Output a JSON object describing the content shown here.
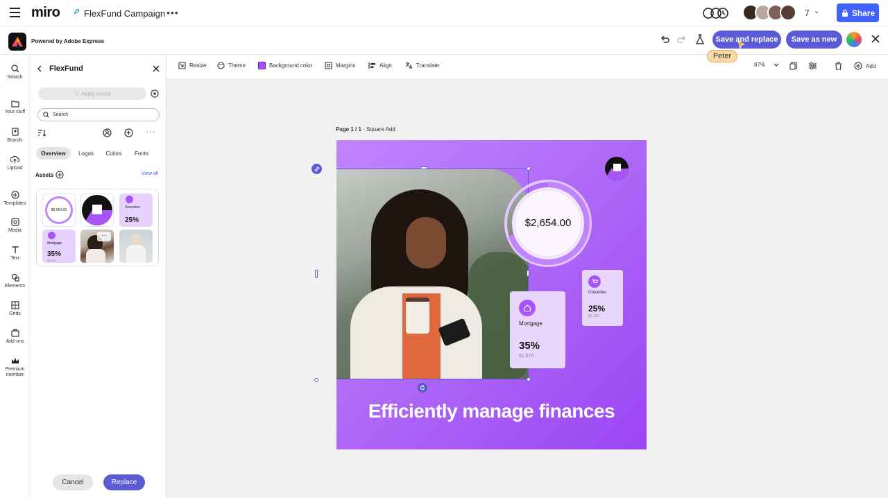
{
  "topbar": {
    "app_name": "miro",
    "board_title": "FlexFund Campaign",
    "collaborator_count": "7",
    "share_label": "Share"
  },
  "express": {
    "powered_by": "Powered by Adobe Express",
    "save_replace_label": "Save and replace",
    "save_new_label": "Save as new",
    "cursor_name": "Peter"
  },
  "rail": {
    "items": [
      "Search",
      "Your stuff",
      "Brands",
      "Upload",
      "Templates",
      "Media",
      "Text",
      "Elements",
      "Grids",
      "Add-ons",
      "Premium member"
    ]
  },
  "panel": {
    "title": "FlexFund",
    "apply_brand": "Apply brand",
    "search_placeholder": "Search",
    "tabs": [
      "Overview",
      "Logos",
      "Colors",
      "Fonts"
    ],
    "assets_label": "Assets",
    "view_all": "View all",
    "thumb_amount": "$2,654.00",
    "thumb_groceries": "Groceries",
    "thumb_groceries_pct": "25%",
    "thumb_mortgage": "Mortgage",
    "thumb_mortgage_pct": "35%",
    "thumb_mortgage_amt": "$1,575",
    "cancel_label": "Cancel",
    "replace_label": "Replace"
  },
  "toolbar": {
    "items": [
      "Resize",
      "Theme",
      "Background color",
      "Margins",
      "Align",
      "Translate"
    ],
    "zoom": "87%",
    "add_label": "Add"
  },
  "design": {
    "page_label": "Page 1 / 1",
    "page_name": " - Square Add",
    "amount": "$2,654.00",
    "groceries_label": "Groceries",
    "groceries_pct": "25%",
    "groceries_amt": "$1,125",
    "mortgage_label": "Mortgage",
    "mortgage_pct": "35%",
    "mortgage_amt": "$1,575",
    "headline": "Efficiently manage finances",
    "ring_progress": 0.7
  },
  "colors": {
    "accent": "#5b5bd6",
    "purple": "#a855f7",
    "purple_light": "#c084fc",
    "cursor_tag": "#fcd9a8"
  }
}
